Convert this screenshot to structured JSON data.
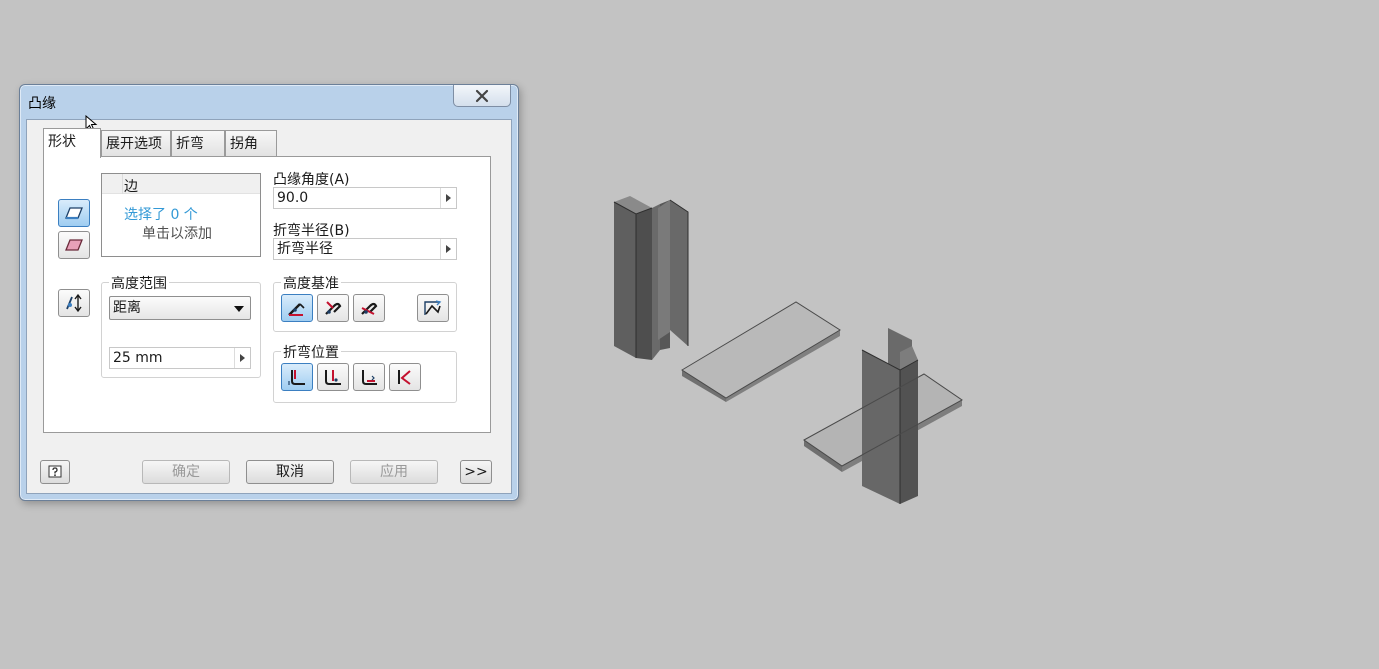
{
  "dialog": {
    "title": "凸缘",
    "tabs": [
      {
        "label": "形状",
        "active": true
      },
      {
        "label": "展开选项"
      },
      {
        "label": "折弯"
      },
      {
        "label": "拐角"
      }
    ],
    "edge_list": {
      "column": "边",
      "selected": "选择了 0 个",
      "hint": "单击以添加"
    },
    "flange_angle": {
      "label": "凸缘角度(A)",
      "value": "90.0"
    },
    "bend_radius": {
      "label": "折弯半径(B)",
      "value": "折弯半径"
    },
    "height_extent": {
      "label": "高度范围",
      "selected": "距离",
      "distance": "25 mm"
    },
    "height_datum": {
      "label": "高度基准"
    },
    "bend_position": {
      "label": "折弯位置"
    },
    "buttons": {
      "ok": "确定",
      "cancel": "取消",
      "apply": "应用",
      "more": ">>"
    }
  },
  "colors": {
    "accent": "#3399d6",
    "selected_button": "#9fcdf1",
    "viewport": "#c3c3c3"
  }
}
